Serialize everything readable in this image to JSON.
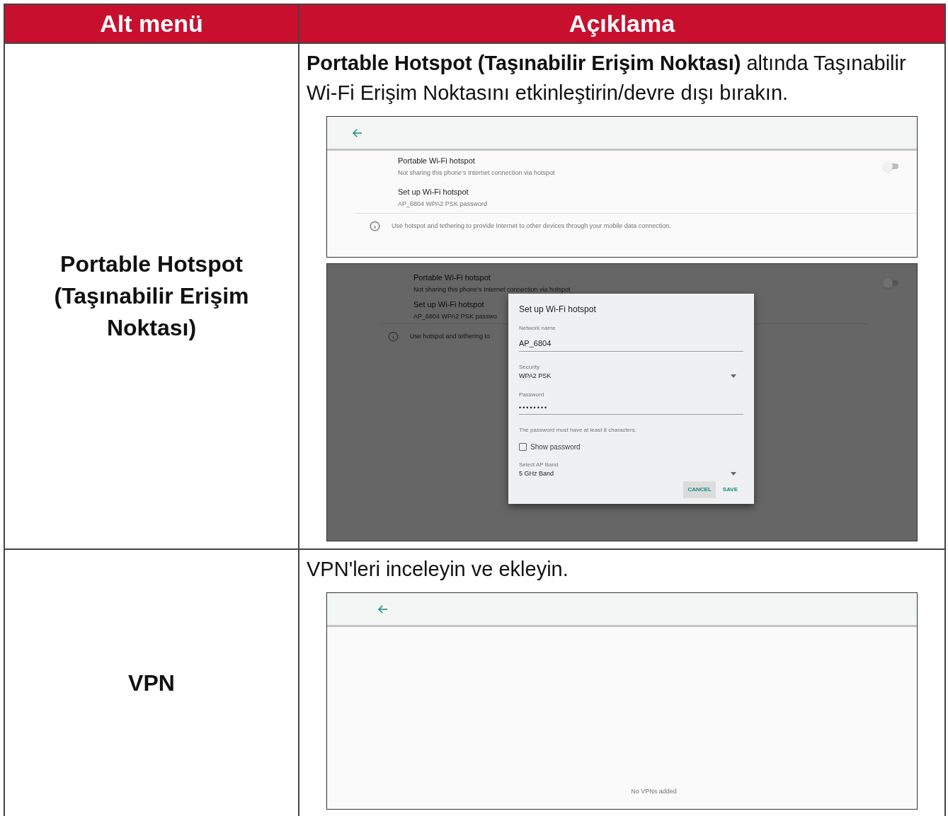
{
  "table": {
    "columns": [
      "Alt menü",
      "Açıklama"
    ],
    "rows": [
      {
        "submenu": "Portable Hotspot (Taşınabilir Erişim Noktası)",
        "description": "**Portable Hotspot (Taşınabilir Erişim Noktası)** altında Taşınabilir Wi-Fi Erişim Noktasını etkinleştirin/devre dışı bırakın.",
        "screens": [
          {
            "kind": "settings",
            "items": [
              {
                "title": "Portable Wi-Fi hotspot",
                "subtitle": "Not sharing this phone’s Internet connection via hotspot",
                "toggle": {
                  "on": false
                }
              },
              {
                "title": "Set up Wi-Fi hotspot",
                "subtitle": "AP_6804 WPA2 PSK password"
              }
            ],
            "info": "Use hotspot and tethering to provide Internet to other devices through your mobile data connection."
          },
          {
            "kind": "dialog",
            "items": [
              {
                "title": "Portable Wi-Fi hotspot",
                "subtitle": "Not sharing this phone’s Internet connection via hotspot",
                "toggle": {
                  "on": false
                }
              },
              {
                "title": "Set up Wi-Fi hotspot",
                "subtitle": "AP_6804 WPA2 PSK passwo"
              }
            ],
            "info": "Use hotspot and tethering to",
            "dialog": {
              "title": "Set up Wi-Fi hotspot",
              "network_name": {
                "label": "Network name",
                "value": "AP_6804"
              },
              "security": {
                "label": "Security",
                "value": "WPA2 PSK"
              },
              "password": {
                "label": "Password",
                "value": "••••••••"
              },
              "hint": "The password must have at least 8 characters.",
              "show_password": {
                "label": "Show password",
                "checked": false
              },
              "ap_band": {
                "label": "Select AP Band",
                "value": "5 GHz Band"
              },
              "buttons": [
                {
                  "label": "CANCEL",
                  "focused": true
                },
                {
                  "label": "SAVE",
                  "focused": false
                }
              ]
            }
          }
        ]
      },
      {
        "submenu": "VPN",
        "description": "VPN'leri inceleyin ve ekleyin.",
        "screens": [
          {
            "kind": "empty",
            "message": "No VPNs added"
          }
        ]
      }
    ]
  }
}
